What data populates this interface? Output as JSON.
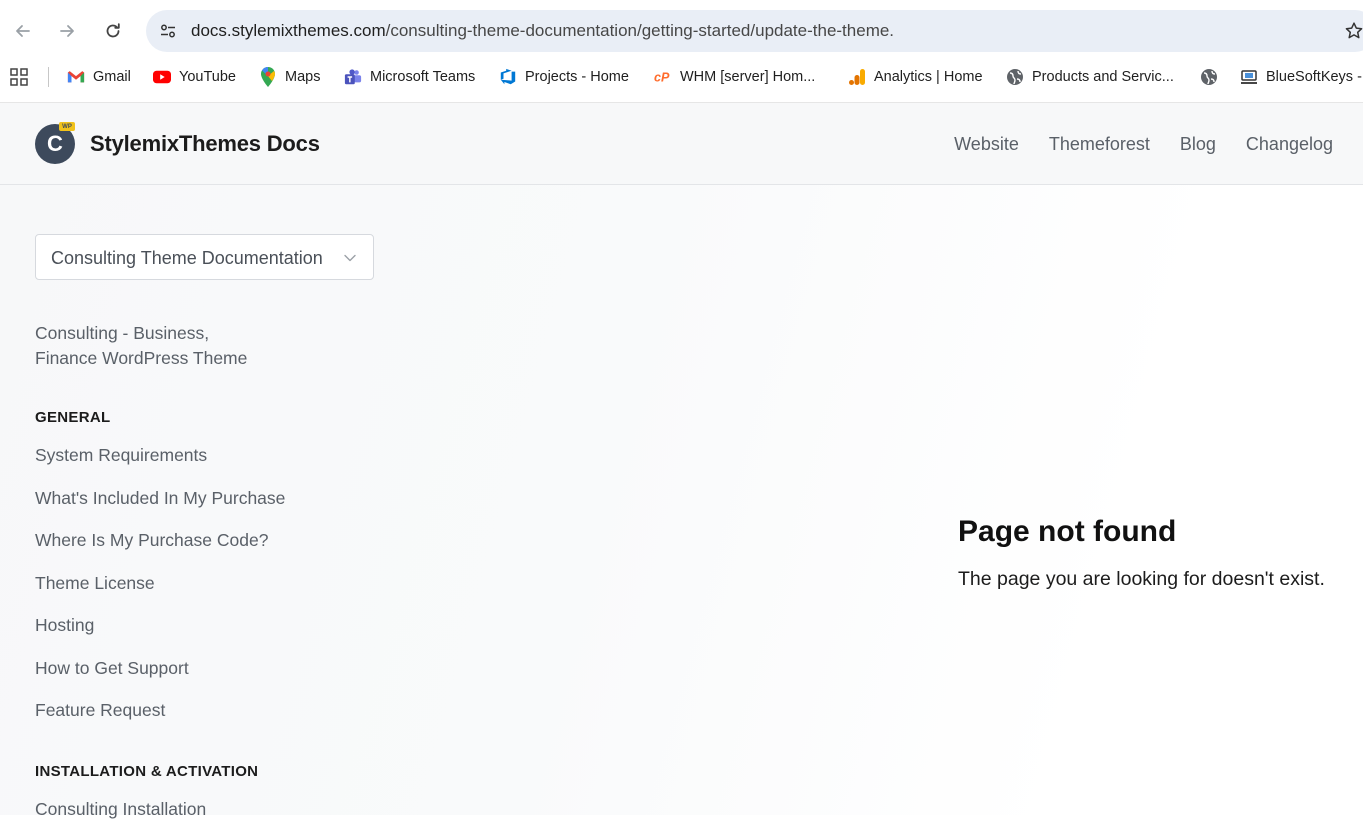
{
  "browser": {
    "url_host": "docs.stylemixthemes.com",
    "url_path": "/consulting-theme-documentation/getting-started/update-the-theme.",
    "bookmarks": [
      {
        "label": "Gmail",
        "icon": "gmail-icon"
      },
      {
        "label": "YouTube",
        "icon": "youtube-icon"
      },
      {
        "label": "Maps",
        "icon": "maps-icon"
      },
      {
        "label": "Microsoft Teams",
        "icon": "teams-icon"
      },
      {
        "label": "Projects - Home",
        "icon": "azure-devops-icon"
      },
      {
        "label": "WHM [server] Hom...",
        "icon": "cpanel-icon"
      },
      {
        "label": "Analytics | Home",
        "icon": "analytics-icon"
      },
      {
        "label": "Products and Servic...",
        "icon": "globe-icon"
      },
      {
        "label": "",
        "icon": "globe-icon"
      },
      {
        "label": "BlueSoftKeys -",
        "icon": "bluesoftkeys-icon"
      }
    ]
  },
  "site": {
    "brand": "StylemixThemes Docs",
    "logo_letter": "C",
    "logo_badge": "WP",
    "nav": [
      "Website",
      "Themeforest",
      "Blog",
      "Changelog"
    ],
    "doc_selector": "Consulting Theme Documentation",
    "theme_link_line1": "Consulting - Business,",
    "theme_link_line2": "Finance WordPress Theme",
    "sections": [
      {
        "title": "GENERAL",
        "items": [
          "System Requirements",
          "What's Included In My Purchase",
          "Where Is My Purchase Code?",
          "Theme License",
          "Hosting",
          "How to Get Support",
          "Feature Request"
        ]
      },
      {
        "title": "INSTALLATION & ACTIVATION",
        "items": [
          "Consulting Installation"
        ]
      }
    ],
    "not_found_title": "Page not found",
    "not_found_text": "The page you are looking for doesn't exist."
  },
  "colors": {
    "logo_bg": "#3d4a5c",
    "omnibox_bg": "#e9eef6",
    "link_gray": "#5a6068"
  }
}
